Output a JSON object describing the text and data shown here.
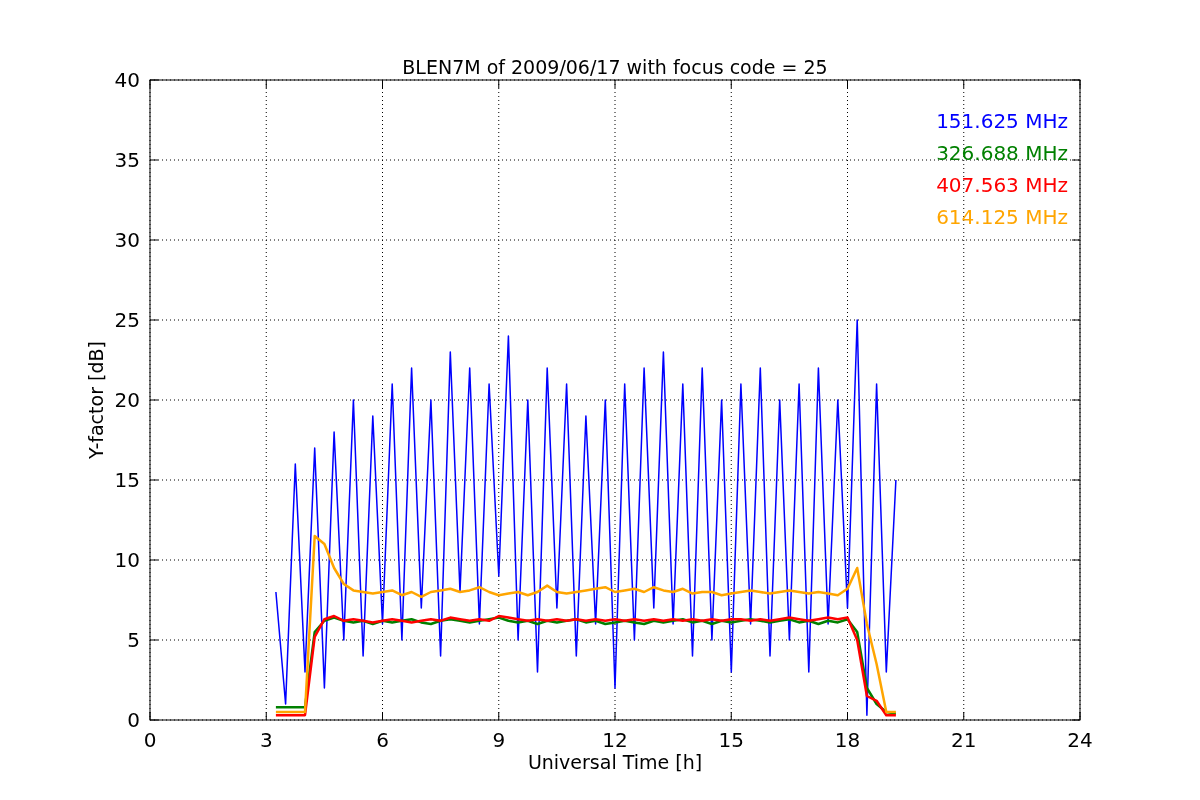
{
  "chart_data": {
    "type": "line",
    "title": "BLEN7M of 2009/06/17 with focus code = 25",
    "xlabel": "Universal Time [h]",
    "ylabel": "Y-factor [dB]",
    "x": [
      3.25,
      3.5,
      3.75,
      4.0,
      4.25,
      4.5,
      4.75,
      5.0,
      5.25,
      5.5,
      5.75,
      6.0,
      6.25,
      6.5,
      6.75,
      7.0,
      7.25,
      7.5,
      7.75,
      8.0,
      8.25,
      8.5,
      8.75,
      9.0,
      9.25,
      9.5,
      9.75,
      10.0,
      10.25,
      10.5,
      10.75,
      11.0,
      11.25,
      11.5,
      11.75,
      12.0,
      12.25,
      12.5,
      12.75,
      13.0,
      13.25,
      13.5,
      13.75,
      14.0,
      14.25,
      14.5,
      14.75,
      15.0,
      15.25,
      15.5,
      15.75,
      16.0,
      16.25,
      16.5,
      16.75,
      17.0,
      17.25,
      17.5,
      17.75,
      18.0,
      18.25,
      18.5,
      18.75,
      19.0,
      19.25
    ],
    "series": [
      {
        "name": "151.625 MHz",
        "color": "#0000ff",
        "values": [
          8,
          1,
          16,
          3,
          17,
          2,
          18,
          5,
          20,
          4,
          19,
          6,
          21,
          5,
          22,
          7,
          20,
          4,
          23,
          8,
          22,
          6,
          21,
          9,
          24,
          5,
          20,
          3,
          22,
          7,
          21,
          4,
          19,
          6,
          20,
          2,
          21,
          5,
          22,
          7,
          23,
          6,
          21,
          4,
          22,
          5,
          20,
          3,
          21,
          6,
          22,
          4,
          20,
          5,
          21,
          3,
          22,
          6,
          20,
          7,
          25,
          0.3,
          21,
          3,
          15
        ]
      },
      {
        "name": "326.688 MHz",
        "color": "#008000",
        "values": [
          0.8,
          0.8,
          0.8,
          0.8,
          5.5,
          6.2,
          6.4,
          6.2,
          6.1,
          6.2,
          6.0,
          6.2,
          6.1,
          6.2,
          6.3,
          6.1,
          6.0,
          6.2,
          6.3,
          6.2,
          6.1,
          6.2,
          6.3,
          6.4,
          6.2,
          6.1,
          6.2,
          6.0,
          6.2,
          6.1,
          6.2,
          6.3,
          6.1,
          6.2,
          6.0,
          6.1,
          6.2,
          6.1,
          6.0,
          6.2,
          6.1,
          6.2,
          6.3,
          6.1,
          6.2,
          6.0,
          6.2,
          6.1,
          6.2,
          6.3,
          6.2,
          6.1,
          6.2,
          6.3,
          6.1,
          6.2,
          6.0,
          6.2,
          6.1,
          6.3,
          5.5,
          2,
          1,
          0.5,
          0.4
        ]
      },
      {
        "name": "407.563 MHz",
        "color": "#ff0000",
        "values": [
          0.3,
          0.3,
          0.3,
          0.3,
          5.2,
          6.3,
          6.5,
          6.2,
          6.3,
          6.2,
          6.1,
          6.2,
          6.3,
          6.2,
          6.1,
          6.2,
          6.3,
          6.2,
          6.4,
          6.3,
          6.2,
          6.3,
          6.2,
          6.5,
          6.4,
          6.3,
          6.2,
          6.3,
          6.2,
          6.3,
          6.2,
          6.3,
          6.2,
          6.3,
          6.2,
          6.3,
          6.2,
          6.3,
          6.2,
          6.3,
          6.2,
          6.3,
          6.2,
          6.3,
          6.2,
          6.3,
          6.2,
          6.3,
          6.3,
          6.2,
          6.3,
          6.2,
          6.3,
          6.4,
          6.3,
          6.2,
          6.3,
          6.4,
          6.3,
          6.4,
          5,
          1.5,
          1.2,
          0.3,
          0.3
        ]
      },
      {
        "name": "614.125 MHz",
        "color": "#ffa500",
        "values": [
          0.5,
          0.5,
          0.5,
          0.5,
          11.5,
          11,
          9.5,
          8.5,
          8.1,
          8,
          7.9,
          8,
          8.1,
          7.8,
          8,
          7.7,
          8,
          8.1,
          8.2,
          8,
          8.1,
          8.3,
          8,
          7.8,
          7.9,
          8,
          7.8,
          8,
          8.4,
          8,
          7.9,
          8,
          8.1,
          8.2,
          8.3,
          8,
          8.1,
          8.2,
          8,
          8.3,
          8.1,
          8,
          8.2,
          7.9,
          8,
          8,
          7.8,
          7.9,
          8,
          8.1,
          8,
          7.9,
          8,
          8.1,
          8,
          7.9,
          8,
          7.9,
          7.8,
          8.2,
          9.5,
          6,
          3.5,
          0.5,
          0.5
        ]
      }
    ],
    "grid": true,
    "xlim": [
      0,
      24
    ],
    "ylim": [
      0,
      40
    ],
    "xticks": [
      0,
      3,
      6,
      9,
      12,
      15,
      18,
      21,
      24
    ],
    "yticks": [
      0,
      5,
      10,
      15,
      20,
      25,
      30,
      35,
      40
    ]
  }
}
